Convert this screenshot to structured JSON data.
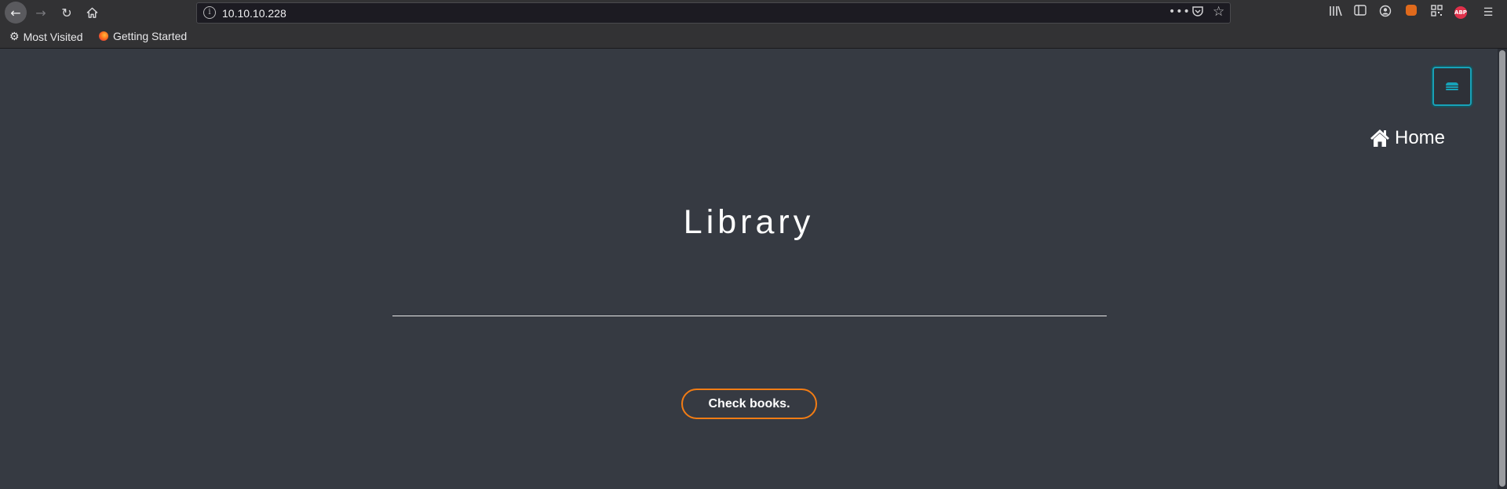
{
  "browser": {
    "url": "10.10.10.228",
    "bookmarks": [
      {
        "label": "Most Visited",
        "icon": "gear-icon"
      },
      {
        "label": "Getting Started",
        "icon": "firefox-icon"
      }
    ],
    "abp_label": "ABP"
  },
  "page": {
    "nav": {
      "home_label": "Home",
      "menu_icon": "hamburger-icon"
    },
    "title": "Library",
    "button_label": "Check books."
  },
  "colors": {
    "background": "#363a42",
    "toggle_accent": "#17a2b8",
    "button_border": "#f27c14",
    "text": "#ffffff"
  }
}
